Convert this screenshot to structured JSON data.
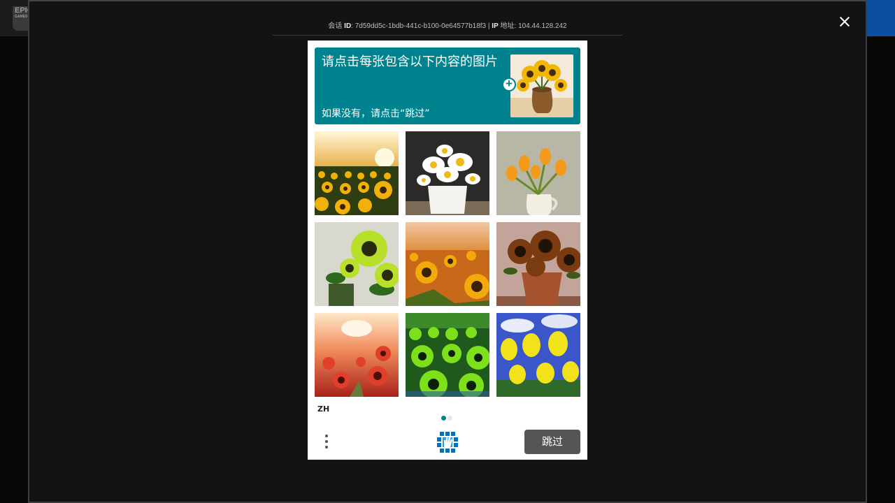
{
  "background": {
    "logo": {
      "line1": "EPIC",
      "line2": "GAMES"
    }
  },
  "modal": {
    "session": {
      "id_prefix": "会话",
      "id_label": "ID",
      "id_value": "7d59dd5c-1bdb-441c-b100-0e64577b18f3",
      "separator": "|",
      "ip_label": "IP",
      "ip_suffix": "地址",
      "ip_value": "104.44.128.242"
    }
  },
  "captcha": {
    "prompt_title": "请点击每张包含以下内容的图片",
    "prompt_subtitle": "如果没有，请点击“跳过”",
    "prompt_image": "sunflower-vase",
    "tiles": [
      {
        "subject": "sunflower-field-sunset"
      },
      {
        "subject": "daisies-in-pot"
      },
      {
        "subject": "tulips-in-pitcher"
      },
      {
        "subject": "sunflowers-in-vase"
      },
      {
        "subject": "sunflower-field"
      },
      {
        "subject": "sunflowers-in-pot"
      },
      {
        "subject": "red-sunflower-field"
      },
      {
        "subject": "green-sunflower-field"
      },
      {
        "subject": "yellow-tulips"
      }
    ],
    "language": "ZH",
    "page_indicator": {
      "current": 1,
      "total": 2
    },
    "next_label": "跳过",
    "colors": {
      "accent": "#00838f",
      "button": "#555555"
    }
  }
}
